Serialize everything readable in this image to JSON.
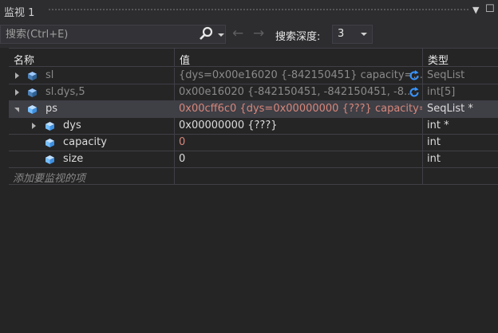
{
  "window": {
    "title": "监视 1"
  },
  "toolbar": {
    "search_placeholder": "搜索(Ctrl+E)",
    "depth_label": "搜索深度:",
    "depth_value": "3"
  },
  "columns": {
    "name": "名称",
    "value": "值",
    "type": "类型"
  },
  "rows": [
    {
      "name": "sl",
      "value": "{dys=0x00e16020 {-842150451} capacity=...",
      "type": "SeqList"
    },
    {
      "name": "sl.dys,5",
      "value": "0x00e16020 {-842150451, -842150451, -8...",
      "type": "int[5]"
    },
    {
      "name": "ps",
      "value": "0x00cff6c0 {dys=0x00000000 {???} capacity=...",
      "type": "SeqList *"
    },
    {
      "name": "dys",
      "value": "0x00000000 {???}",
      "type": "int *"
    },
    {
      "name": "capacity",
      "value": "0",
      "type": "int"
    },
    {
      "name": "size",
      "value": "0",
      "type": "int"
    }
  ],
  "add_item_placeholder": "添加要监视的项",
  "colors": {
    "stale": "#8a8a8a",
    "changed": "#d7877a",
    "selected": "#3f3f46",
    "icon": "#75beff",
    "refresh": "#3794ff"
  }
}
